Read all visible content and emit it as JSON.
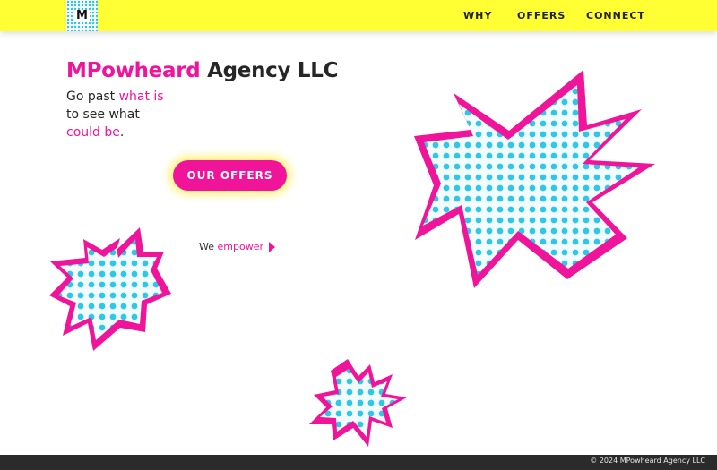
{
  "header": {
    "logo_letter": "M",
    "nav": [
      {
        "label": "WHY"
      },
      {
        "label": "OFFERS"
      },
      {
        "label": "CONNECT"
      }
    ]
  },
  "hero": {
    "title_accent": "MPowheard",
    "title_rest": " Agency LLC",
    "tagline": {
      "line1_plain": "Go past ",
      "line1_accent": "what is",
      "line2": "to see what",
      "line3_accent": "could be",
      "line3_end": "."
    },
    "cta_label": "OUR OFFERS",
    "empower_plain": "We ",
    "empower_accent": "empower"
  },
  "footer": {
    "copyright": "© 2024 MPowheard Agency LLC"
  },
  "colors": {
    "accent_pink": "#f0149b",
    "header_yellow": "#ffff33",
    "dot_cyan": "#2ec7e6",
    "footer_dark": "#2b2b2b"
  }
}
